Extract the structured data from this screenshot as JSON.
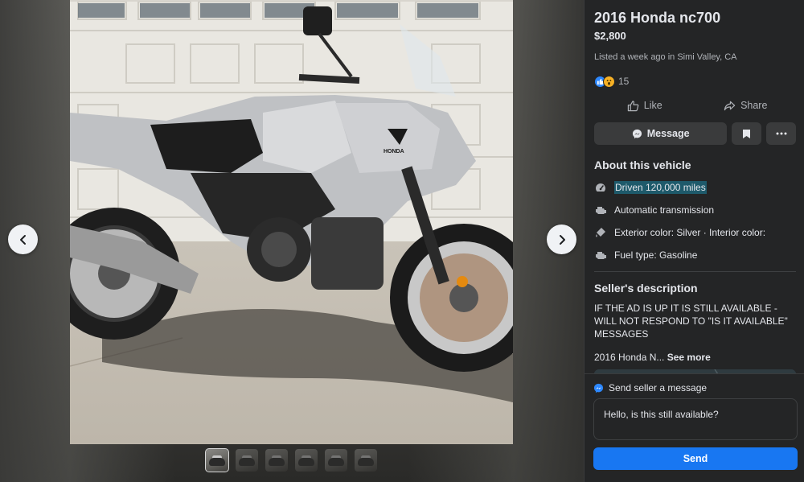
{
  "listing": {
    "title": "2016 Honda nc700",
    "price": "$2,800",
    "listed": "Listed a week ago in Simi Valley, CA",
    "reaction_count": "15",
    "reactions": [
      "like",
      "wow"
    ]
  },
  "actions": {
    "like_label": "Like",
    "share_label": "Share",
    "message_label": "Message"
  },
  "about": {
    "heading": "About this vehicle",
    "items": [
      {
        "icon": "speedometer-icon",
        "text": "Driven 120,000 miles"
      },
      {
        "icon": "engine-icon",
        "text": "Automatic transmission"
      },
      {
        "icon": "paint-icon",
        "text": "Exterior color: Silver · Interior color:"
      },
      {
        "icon": "fuel-icon",
        "text": "Fuel type: Gasoline"
      }
    ]
  },
  "seller": {
    "heading": "Seller's description",
    "description": "IF THE AD IS UP IT IS STILL AVAILABLE - WILL NOT RESPOND TO \"IS IT AVAILABLE\" MESSAGES",
    "preview": "2016 Honda N...",
    "see_more": "See more"
  },
  "messaging": {
    "header": "Send seller a message",
    "input_value": "Hello, is this still available?",
    "send_label": "Send"
  },
  "gallery": {
    "thumbnail_count": 6,
    "active_index": 0
  },
  "colors": {
    "panel_bg": "#242526",
    "accent": "#1877f2",
    "highlight": "#1e5a6b"
  }
}
